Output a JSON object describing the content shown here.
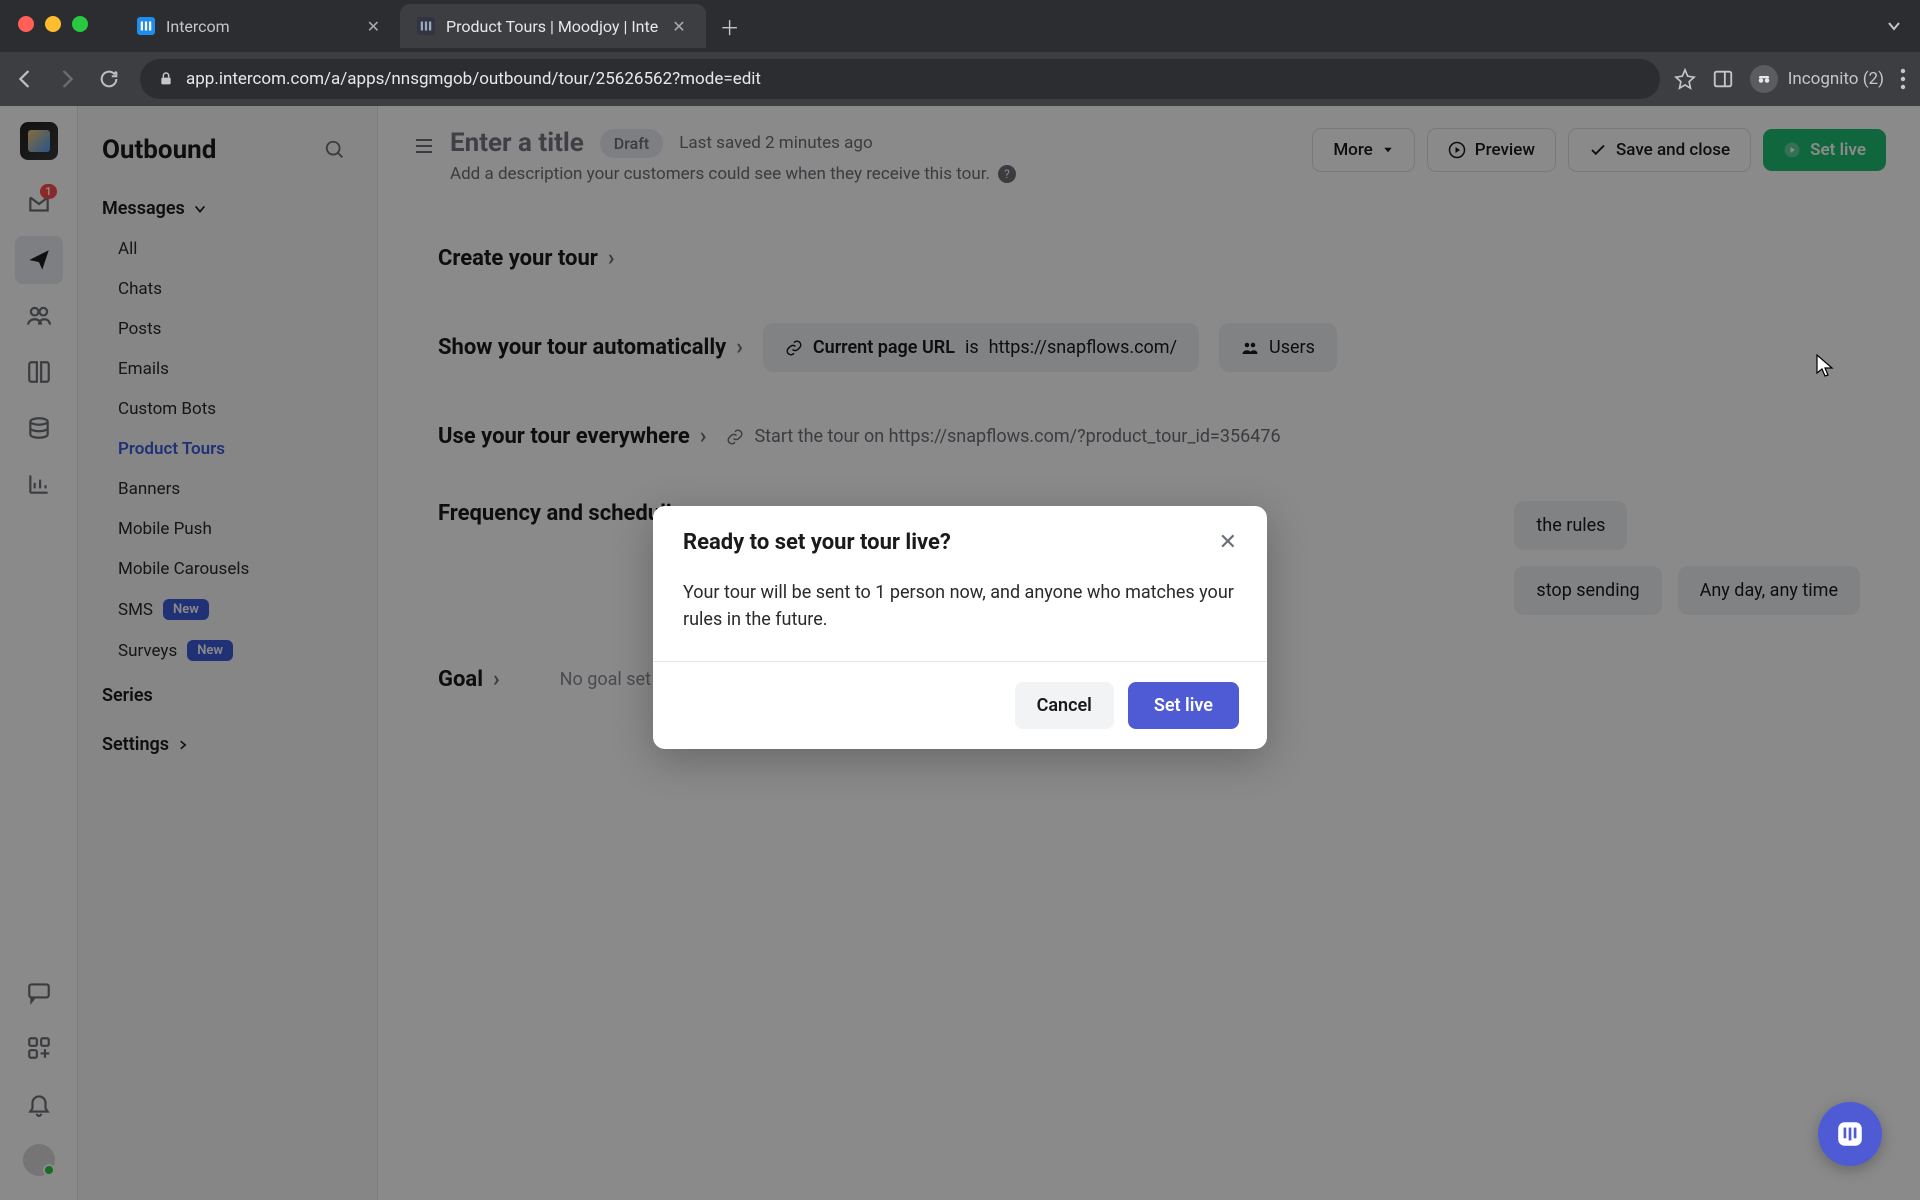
{
  "browser": {
    "tabs": [
      {
        "title": "Intercom"
      },
      {
        "title": "Product Tours | Moodjoy | Inte"
      }
    ],
    "url": "app.intercom.com/a/apps/nnsgmgob/outbound/tour/25626562?mode=edit",
    "incognito": "Incognito (2)"
  },
  "sidebar": {
    "title": "Outbound",
    "group": "Messages",
    "items": [
      "All",
      "Chats",
      "Posts",
      "Emails",
      "Custom Bots",
      "Product Tours",
      "Banners",
      "Mobile Push",
      "Mobile Carousels",
      "SMS",
      "Surveys"
    ],
    "new_label": "New",
    "series": "Series",
    "settings": "Settings"
  },
  "rail": {
    "inbox_badge": "1"
  },
  "header": {
    "title": "Enter a title",
    "draft": "Draft",
    "saved": "Last saved 2 minutes ago",
    "desc": "Add a description your customers could see when they receive this tour.",
    "more": "More",
    "preview": "Preview",
    "save_close": "Save and close",
    "set_live": "Set live"
  },
  "sections": {
    "create": "Create your tour",
    "show_auto": "Show your tour automatically",
    "url_rule_label": "Current page URL",
    "url_rule_op": "is",
    "url_rule_val": "https://snapflows.com/",
    "users": "Users",
    "use_everywhere": "Use your tour everywhere",
    "start_tour": "Start the tour on https://snapflows.com/?product_tour_id=356476",
    "frequency": "Frequency and scheduling",
    "rules_pill": "the rules",
    "stop_pill": "stop sending",
    "anytime_pill": "Any day, any time",
    "goal": "Goal",
    "no_goal": "No goal set"
  },
  "modal": {
    "title": "Ready to set your tour live?",
    "body": "Your tour will be sent to 1 person now, and anyone who matches your rules in the future.",
    "cancel": "Cancel",
    "confirm": "Set live"
  }
}
